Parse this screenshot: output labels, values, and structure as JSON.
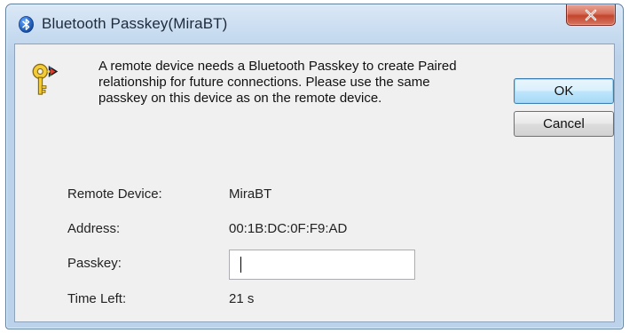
{
  "window": {
    "title": "Bluetooth Passkey(MiraBT)",
    "title_icon": "bluetooth-icon",
    "close_icon": "close-x-icon"
  },
  "message": {
    "icon": "key-icon",
    "lines": [
      "A remote device needs a Bluetooth Passkey to create Paired",
      "relationship for future connections. Please use the same",
      "passkey on this device as on the remote device."
    ]
  },
  "buttons": {
    "ok_label": "OK",
    "cancel_label": "Cancel"
  },
  "fields": {
    "remote_device_label": "Remote Device:",
    "remote_device_value": "MiraBT",
    "address_label": "Address:",
    "address_value": "00:1B:DC:0F:F9:AD",
    "passkey_label": "Passkey:",
    "passkey_value": "",
    "time_left_label": "Time Left:",
    "time_left_value": "21 s"
  },
  "colors": {
    "frame": "#bcd2ea",
    "client": "#f0f0f0",
    "close_button": "#c4452d",
    "bluetooth": "#1a5db5"
  }
}
